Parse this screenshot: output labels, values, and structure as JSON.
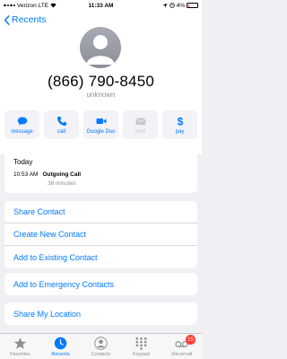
{
  "status_bar": {
    "carrier": "Verizon",
    "network": "LTE",
    "time": "11:33 AM",
    "battery": "4%"
  },
  "nav": {
    "back_label": "Recents"
  },
  "contact": {
    "phone": "(866) 790-8450",
    "label": "unknown"
  },
  "actions": [
    {
      "label": "message",
      "icon": "message-icon",
      "enabled": true
    },
    {
      "label": "call",
      "icon": "phone-icon",
      "enabled": true
    },
    {
      "label": "Google Duo",
      "icon": "video-icon",
      "enabled": true
    },
    {
      "label": "mail",
      "icon": "mail-icon",
      "enabled": false
    },
    {
      "label": "pay",
      "icon": "dollar-icon",
      "enabled": true
    }
  ],
  "call_log": {
    "date": "Today",
    "time": "10:53 AM",
    "type": "Outgoing Call",
    "duration": "38 minutes"
  },
  "menu_group_1": [
    "Share Contact",
    "Create New Contact",
    "Add to Existing Contact"
  ],
  "menu_group_2": [
    "Add to Emergency Contacts"
  ],
  "menu_group_3": [
    "Share My Location"
  ],
  "tabs": [
    {
      "label": "Favorites",
      "icon": "star-icon",
      "active": false
    },
    {
      "label": "Recents",
      "icon": "clock-icon",
      "active": true
    },
    {
      "label": "Contacts",
      "icon": "person-icon",
      "active": false
    },
    {
      "label": "Keypad",
      "icon": "keypad-icon",
      "active": false
    },
    {
      "label": "Voicemail",
      "icon": "voicemail-icon",
      "active": false,
      "badge": "15"
    }
  ],
  "colors": {
    "accent": "#007aff",
    "badge": "#ff3b30",
    "background": "#efeff4"
  }
}
